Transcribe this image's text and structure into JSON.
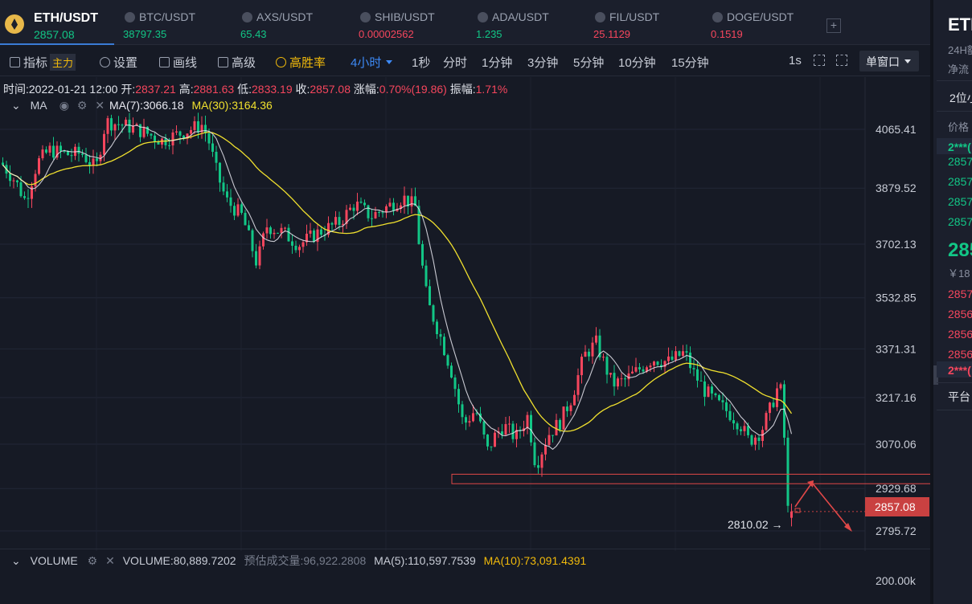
{
  "tickers": [
    {
      "name": "ETH/USDT",
      "price": "2857.08",
      "active": true
    },
    {
      "name": "BTC/USDT",
      "price": "38797.35",
      "color": "#12c686"
    },
    {
      "name": "AXS/USDT",
      "price": "65.43",
      "color": "#12c686"
    },
    {
      "name": "SHIB/USDT",
      "price": "0.00002562",
      "color": "#f6465d"
    },
    {
      "name": "ADA/USDT",
      "price": "1.235",
      "color": "#12c686"
    },
    {
      "name": "FIL/USDT",
      "price": "25.1129",
      "color": "#f6465d"
    },
    {
      "name": "DOGE/USDT",
      "price": "0.1519",
      "color": "#f6465d"
    }
  ],
  "add_label": "+",
  "toolbar": {
    "indicators": "指标",
    "main_badge": "主力",
    "settings": "设置",
    "draw": "画线",
    "advanced": "高级",
    "high_win": "高胜率",
    "interval_selected": "4小时",
    "intervals": [
      "1秒",
      "分时",
      "1分钟",
      "3分钟",
      "5分钟",
      "10分钟",
      "15分钟"
    ],
    "refresh": "1s",
    "window_mode": "单窗口"
  },
  "ohlc": {
    "time_label": "时间:",
    "time": "2022-01-21 12:00",
    "open_label": "开:",
    "open": "2837.21",
    "high_label": "高:",
    "high": "2881.63",
    "low_label": "低:",
    "low": "2833.19",
    "close_label": "收:",
    "close": "2857.08",
    "change_label": "涨幅:",
    "change": "0.70%(19.86)",
    "amp_label": "振幅:",
    "amp": "1.71%"
  },
  "ma_legend": {
    "name": "MA",
    "ma7": "MA(7):3066.18",
    "ma30": "MA(30):3164.36"
  },
  "current_price": "2857.08",
  "low_marker": "2810.02",
  "colors": {
    "up": "#f6465d",
    "down": "#12c686",
    "ma7": "#e8e8f0",
    "ma30": "#f0e02e",
    "zone": "#e04848"
  },
  "chart_data": {
    "type": "candlestick",
    "title": "ETH/USDT 4小时",
    "y_ticks": [
      4065.41,
      3879.52,
      3702.13,
      3532.85,
      3371.31,
      3217.16,
      3070.06,
      2929.68,
      2795.72
    ],
    "last_close": 2857.08,
    "ma7": 3066.18,
    "ma30": 3164.36,
    "support_zone": [
      2945,
      2975
    ],
    "period_low": 2810.02
  },
  "volume": {
    "name": "VOLUME",
    "value": "VOLUME:80,889.7202",
    "estimate": "预估成交量:96,922.2808",
    "ma5": "MA(5):110,597.7539",
    "ma10": "MA(10):73,091.4391",
    "axis_top": "200.00k"
  },
  "right_panel": {
    "title": "ETH",
    "sub1": "24H额",
    "sub2": "净流",
    "tab": "2位小",
    "col_header": "价格",
    "asks": [
      "2***(",
      "2857",
      "2857",
      "2857",
      "2857"
    ],
    "last": "285",
    "cny": "￥18",
    "bids": [
      "2857",
      "2856",
      "2856",
      "2856",
      "2***("
    ],
    "platform": "平台"
  }
}
